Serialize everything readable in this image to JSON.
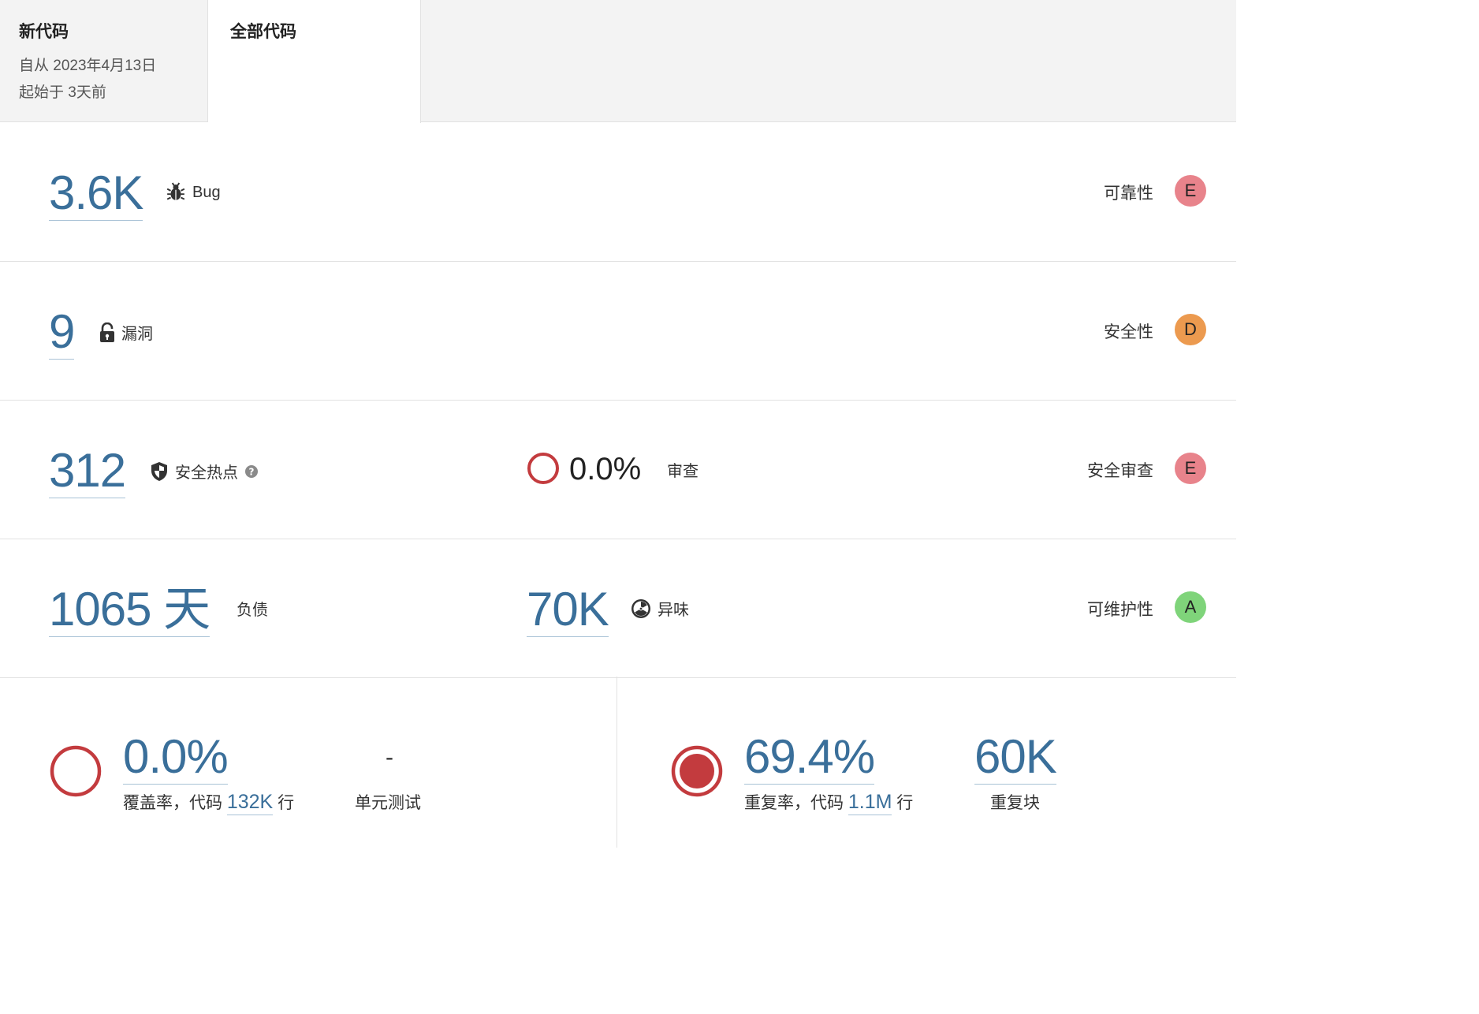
{
  "tabs": {
    "new_code": {
      "title": "新代码",
      "since_line": "自从 2023年4月13日",
      "started_line": "起始于 3天前"
    },
    "overall_code": {
      "title": "全部代码"
    }
  },
  "reliability": {
    "value": "3.6K",
    "label": "Bug",
    "icon": "bug-icon",
    "rating_label": "可靠性",
    "rating": "E",
    "rating_color": "#e8838b"
  },
  "security": {
    "value": "9",
    "label": "漏洞",
    "icon": "open-lock-icon",
    "rating_label": "安全性",
    "rating": "D",
    "rating_color": "#ec9a4f"
  },
  "security_review": {
    "value": "312",
    "label": "安全热点",
    "icon": "shield-icon",
    "help_icon": "help-icon",
    "review_percent": "0.0%",
    "review_label": "审查",
    "review_gauge_color": "#c33b3e",
    "rating_label": "安全审查",
    "rating": "E",
    "rating_color": "#e8838b"
  },
  "maintainability": {
    "debt_value": "1065 天",
    "debt_label": "负债",
    "smells_value": "70K",
    "smells_label": "异味",
    "smells_icon": "radiation-icon",
    "rating_label": "可维护性",
    "rating": "A",
    "rating_color": "#7fd47a"
  },
  "coverage": {
    "value": "0.0%",
    "caption_prefix": "覆盖率，代码",
    "lines": "132K",
    "caption_suffix": "行",
    "unit_tests_value": "-",
    "unit_tests_label": "单元测试",
    "gauge_color": "#c33b3e"
  },
  "duplications": {
    "value": "69.4%",
    "caption_prefix": "重复率，代码",
    "lines": "1.1M",
    "caption_suffix": "行",
    "blocks_value": "60K",
    "blocks_label": "重复块",
    "gauge_color": "#c33b3e"
  }
}
